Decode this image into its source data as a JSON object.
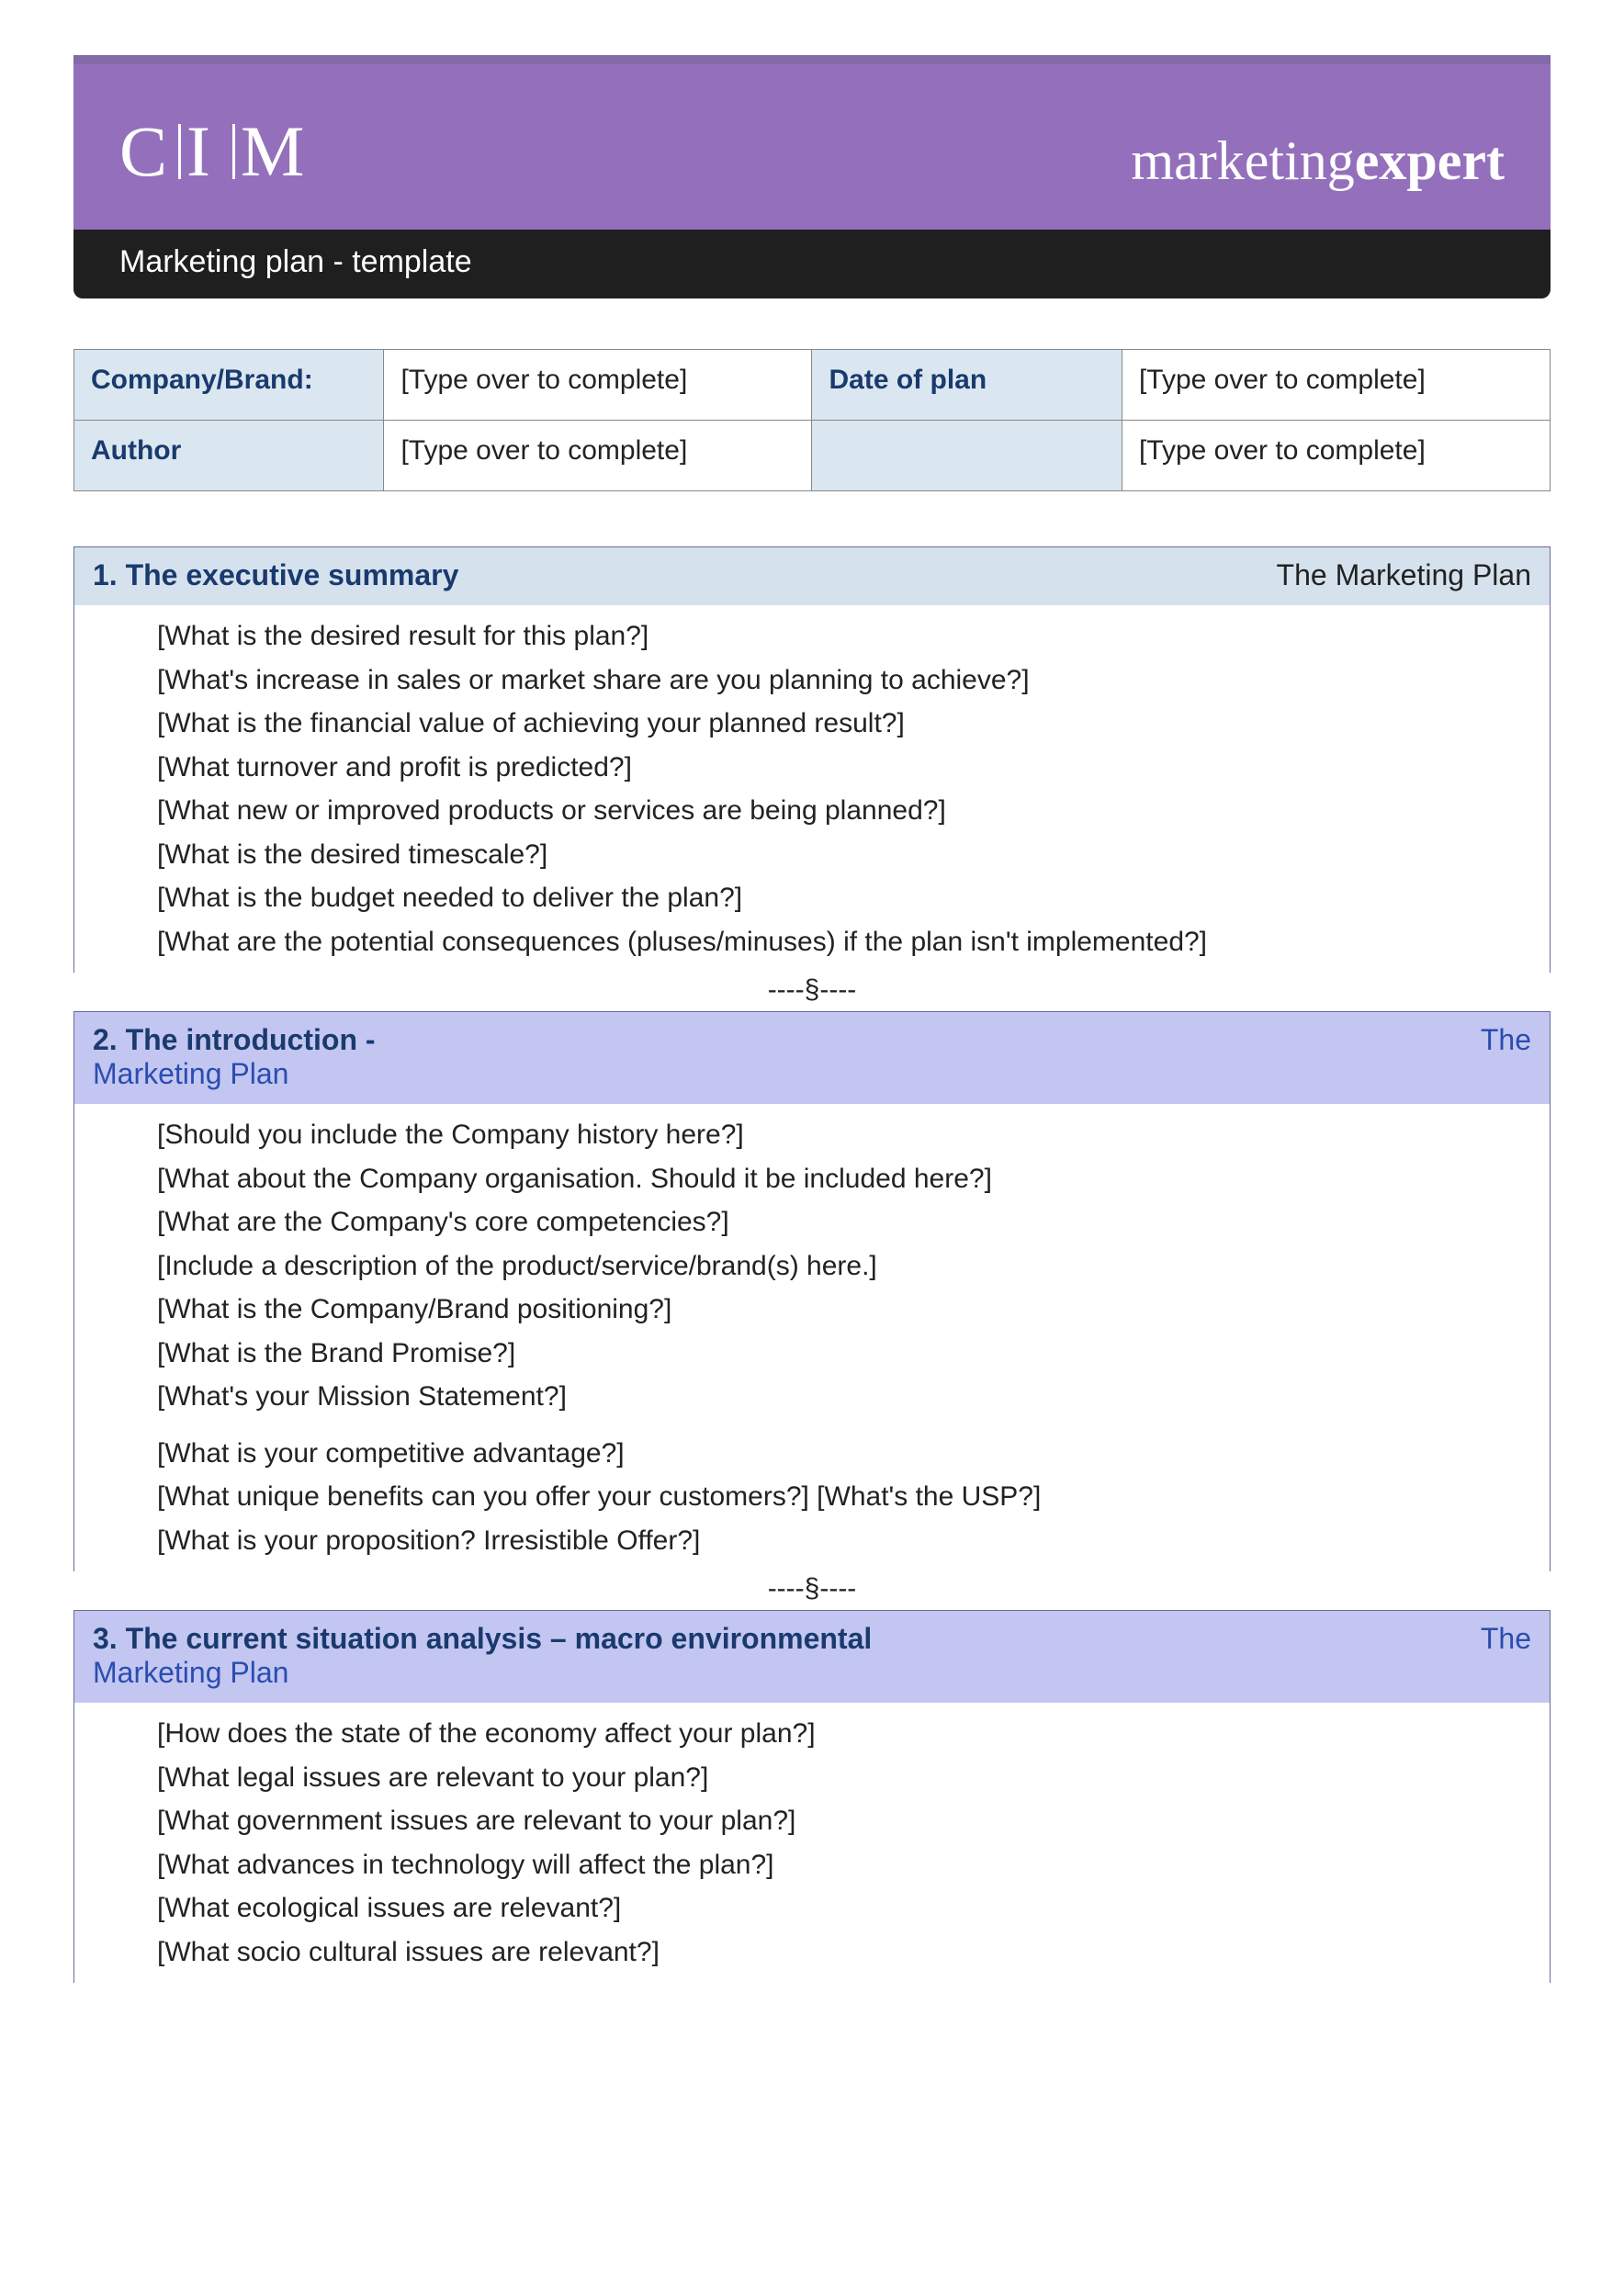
{
  "banner": {
    "logo_c": "C",
    "logo_i": "I",
    "logo_m": "M",
    "brand_light": "marketing",
    "brand_bold": "expert"
  },
  "subbar": "Marketing plan - template",
  "info": {
    "row1": {
      "label1": "Company/Brand:",
      "value1": "[Type over to complete]",
      "label2": "Date of plan",
      "value2": "[Type over to complete]"
    },
    "row2": {
      "label1": "Author",
      "value1": "[Type over to complete]",
      "label2": "",
      "value2": "[Type over to complete]"
    }
  },
  "separator": "----§----",
  "sections": [
    {
      "title": "1.  The executive summary",
      "right": "The Marketing Plan",
      "head_bg": "lightblue",
      "sub": "",
      "lines": [
        "[What is the desired result for this plan?]",
        "[What's increase in sales or market share are you planning to achieve?]",
        "[What is the financial value of achieving your planned result?]",
        "[What turnover and profit is predicted?]",
        "[What new or improved products or services are being planned?]",
        "[What is the desired timescale?]",
        "[What is the budget needed to deliver the plan?]",
        "[What are the potential consequences (pluses/minuses) if the plan isn't implemented?]"
      ]
    },
    {
      "title": "2.  The introduction -",
      "right": "The",
      "head_bg": "lilac",
      "sub": "Marketing Plan",
      "lines": [
        "[Should you include the Company history here?]",
        "[What about the Company organisation.  Should it be included here?]",
        "[What are the Company's core competencies?]",
        "[Include a description of the product/service/brand(s) here.]",
        "[What is the Company/Brand positioning?]",
        "[What is the Brand Promise?]",
        "[What's your Mission Statement?]",
        "GAP",
        "[What is your competitive advantage?]",
        "[What unique benefits can you offer your customers?]  [What's the USP?]",
        "[What is your proposition? Irresistible Offer?]"
      ]
    },
    {
      "title": "3. The current situation analysis – macro environmental",
      "right": "The",
      "head_bg": "lilac",
      "sub": "Marketing Plan",
      "lines": [
        "[How does the state of the economy affect your plan?]",
        "[What legal issues are relevant to your plan?]",
        "[What government issues are relevant to your plan?]",
        "[What advances in technology will affect the plan?]",
        "[What ecological issues are relevant?]",
        "[What socio cultural issues are relevant?]"
      ]
    }
  ]
}
